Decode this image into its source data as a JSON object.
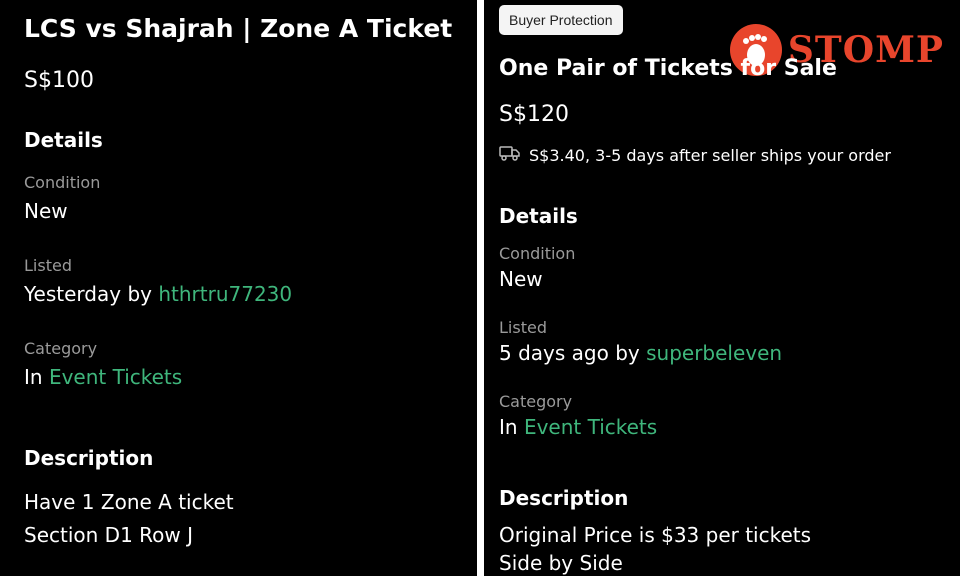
{
  "left": {
    "title": "LCS vs Shajrah | Zone A Ticket",
    "price": "S$100",
    "details_heading": "Details",
    "condition_label": "Condition",
    "condition_value": "New",
    "listed_label": "Listed",
    "listed_prefix": "Yesterday by",
    "listed_user": "hthrtru77230",
    "category_label": "Category",
    "category_prefix": "In",
    "category_value": "Event Tickets",
    "description_heading": "Description",
    "description_lines": [
      "Have 1 Zone A ticket",
      "Section D1 Row J"
    ]
  },
  "right": {
    "badge": "Buyer Protection",
    "title": "One Pair of Tickets for Sale",
    "price": "S$120",
    "shipping_text": "S$3.40, 3-5 days after seller ships your order",
    "details_heading": "Details",
    "condition_label": "Condition",
    "condition_value": "New",
    "listed_label": "Listed",
    "listed_prefix": "5 days ago by",
    "listed_user": "superbeleven",
    "category_label": "Category",
    "category_prefix": "In",
    "category_value": "Event Tickets",
    "description_heading": "Description",
    "description_lines": [
      "Original Price is $33 per tickets",
      "Side by Side"
    ]
  },
  "watermark": {
    "text": "STOMP"
  },
  "colors": {
    "background": "#000000",
    "link": "#3fb67c",
    "watermark": "#e8452c",
    "badge_bg": "#f4f4f4"
  },
  "icons": [
    "truck-icon",
    "footprint-logo-icon"
  ]
}
